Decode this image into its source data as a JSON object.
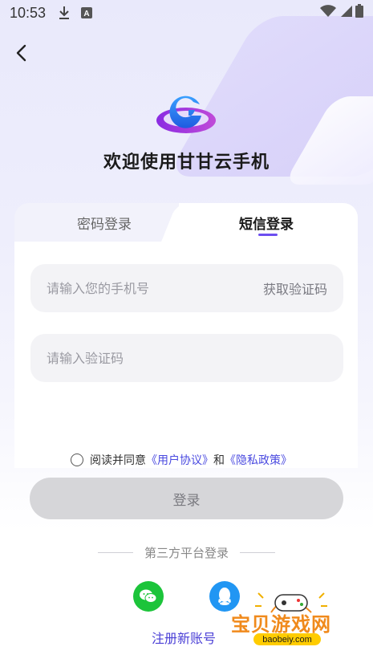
{
  "status_bar": {
    "time": "10:53",
    "icons": [
      "download-icon",
      "a-badge-icon",
      "wifi-icon",
      "signal-icon",
      "battery-icon"
    ]
  },
  "header": {
    "back_icon": "chevron-left-icon",
    "welcome": "欢迎使用甘甘云手机"
  },
  "tabs": [
    {
      "label": "密码登录",
      "active": false
    },
    {
      "label": "短信登录",
      "active": true
    }
  ],
  "form": {
    "phone_placeholder": "请输入您的手机号",
    "get_code": "获取验证码",
    "code_placeholder": "请输入验证码"
  },
  "agreement": {
    "prefix": "阅读并同意",
    "user_agreement": "《用户协议》",
    "and": "和",
    "privacy_policy": "《隐私政策》"
  },
  "login_button": "登录",
  "third_party": {
    "title": "第三方平台登录",
    "options": [
      "wechat-icon",
      "qq-icon"
    ]
  },
  "register_link": "注册新账号",
  "watermark": {
    "text": "宝贝游戏网",
    "url": "baobeiy.com"
  },
  "colors": {
    "accent": "#6c4ef0",
    "link": "#4a4ae0",
    "wechat": "#1cc43a",
    "qq": "#2196f3",
    "button_disabled": "#d6d6d9"
  }
}
